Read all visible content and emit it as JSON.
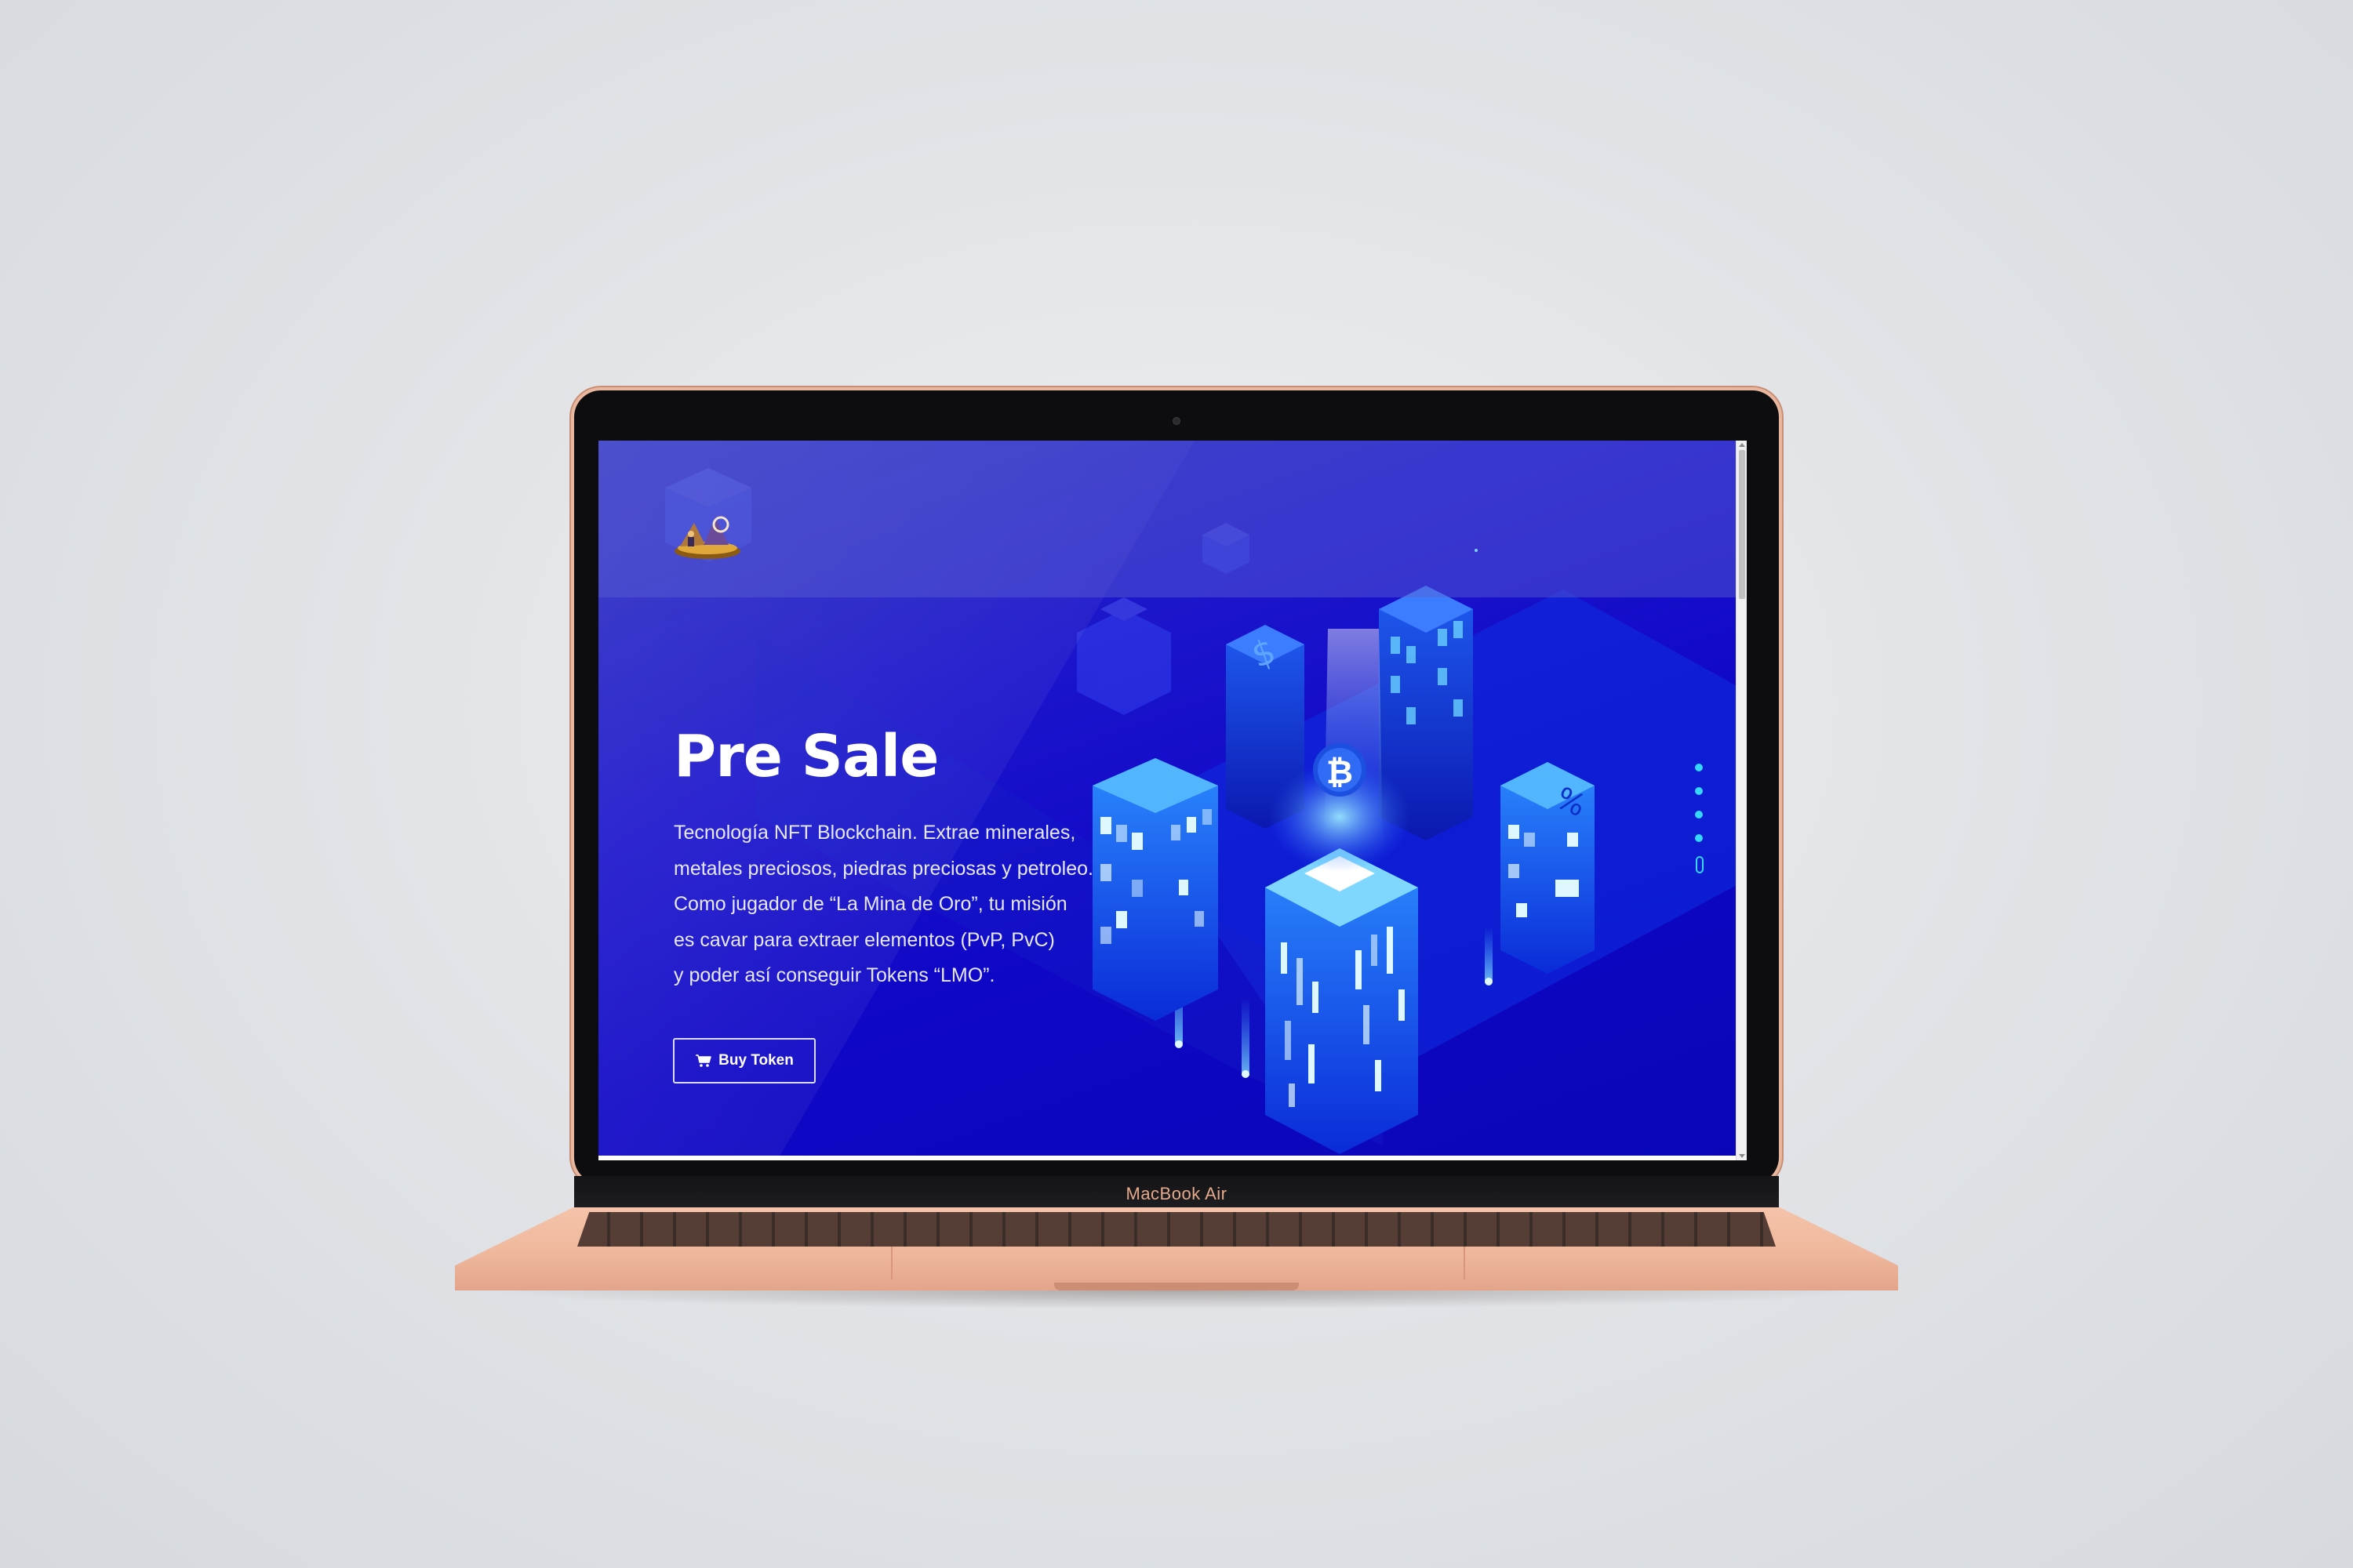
{
  "device": {
    "label": "MacBook Air"
  },
  "page": {
    "hero": {
      "title": "Pre Sale",
      "description_lines": [
        "Tecnología NFT Blockchain. Extrae minerales,",
        "metales preciosos, piedras preciosas y petroleo.",
        "Como jugador de “La Mina de Oro”, tu misión",
        "es cavar para extraer elementos (PvP, PvC)",
        "y poder así conseguir Tokens “LMO”."
      ],
      "cta_label": "Buy Token",
      "cta_icon": "shopping-cart-icon"
    },
    "header": {
      "logo": "la-mina-de-oro-logo"
    },
    "pagination_dots": 4
  },
  "colors": {
    "background": "#1208c8",
    "accent": "#35d6ff",
    "text": "#ffffff",
    "device_rose_gold": "#f0bba0"
  }
}
